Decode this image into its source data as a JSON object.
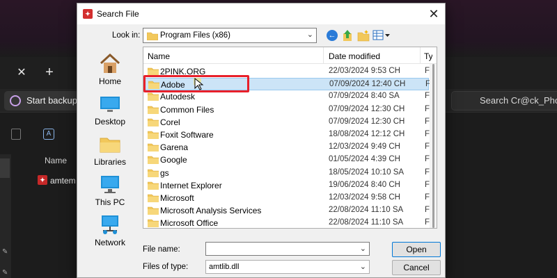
{
  "background": {
    "toolbar": {
      "start_backup_label": "Start backup",
      "search_text": "Search Cr@ck_Pho"
    },
    "files": {
      "column_name": "Name",
      "file_name": "amtem"
    }
  },
  "dialog": {
    "title": "Search File",
    "close_glyph": "✕",
    "look_in": {
      "label": "Look in:",
      "value": "Program Files (x86)"
    },
    "places": [
      {
        "label": "Home",
        "icon": "home-icon"
      },
      {
        "label": "Desktop",
        "icon": "desktop-icon"
      },
      {
        "label": "Libraries",
        "icon": "libraries-icon"
      },
      {
        "label": "This PC",
        "icon": "this-pc-icon"
      },
      {
        "label": "Network",
        "icon": "network-icon"
      }
    ],
    "columns": {
      "name": "Name",
      "date_modified": "Date modified",
      "type": "Ty"
    },
    "rows": [
      {
        "name": "2PINK.ORG",
        "date": "22/03/2024 9:53 CH",
        "type": "Fil"
      },
      {
        "name": "Adobe",
        "date": "07/09/2024 12:40 CH",
        "type": "Fil",
        "selected": true
      },
      {
        "name": "Autodesk",
        "date": "07/09/2024 8:40 SA",
        "type": "Fil"
      },
      {
        "name": "Common Files",
        "date": "07/09/2024 12:30 CH",
        "type": "Fil"
      },
      {
        "name": "Corel",
        "date": "07/09/2024 12:30 CH",
        "type": "Fil"
      },
      {
        "name": "Foxit Software",
        "date": "18/08/2024 12:12 CH",
        "type": "Fil"
      },
      {
        "name": "Garena",
        "date": "12/03/2024 9:49 CH",
        "type": "Fil"
      },
      {
        "name": "Google",
        "date": "01/05/2024 4:39 CH",
        "type": "Fil"
      },
      {
        "name": "gs",
        "date": "18/05/2024 10:10 SA",
        "type": "Fil"
      },
      {
        "name": "Internet Explorer",
        "date": "19/06/2024 8:40 CH",
        "type": "Fil"
      },
      {
        "name": "Microsoft",
        "date": "12/03/2024 9:58 CH",
        "type": "Fil"
      },
      {
        "name": "Microsoft Analysis Services",
        "date": "22/08/2024 11:10 SA",
        "type": "Fil"
      },
      {
        "name": "Microsoft Office",
        "date": "22/08/2024 11:10 SA",
        "type": "Fil"
      }
    ],
    "file_name": {
      "label": "File name:",
      "value": ""
    },
    "file_type": {
      "label": "Files of type:",
      "value": "amtlib.dll"
    },
    "buttons": {
      "open": "Open",
      "cancel": "Cancel"
    }
  },
  "colors": {
    "selection": "#cce4f7",
    "annotation": "#e8202a",
    "folder": "#f2c85b"
  }
}
